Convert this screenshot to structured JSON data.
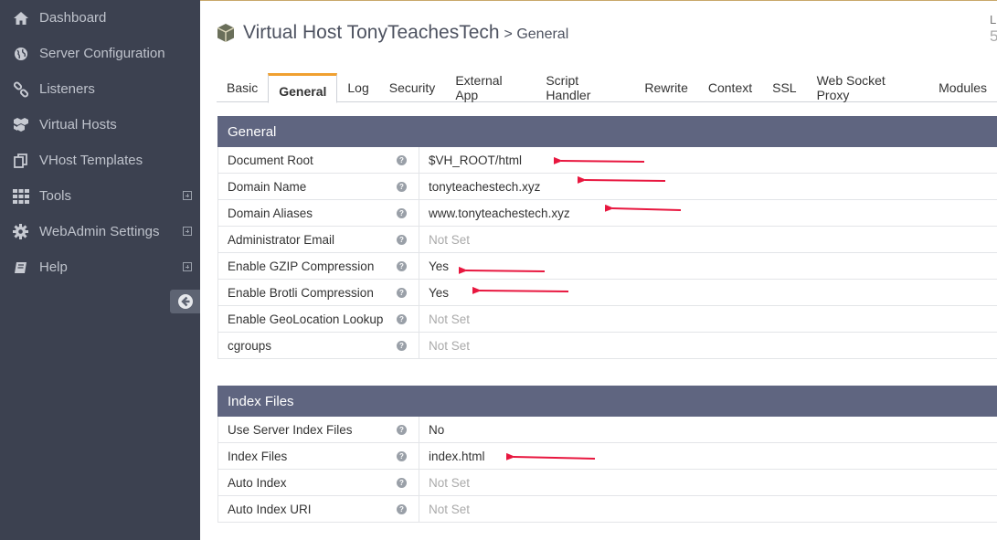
{
  "sidebar": {
    "items": [
      {
        "label": "Dashboard",
        "icon": "home-icon"
      },
      {
        "label": "Server Configuration",
        "icon": "globe-icon"
      },
      {
        "label": "Listeners",
        "icon": "link-icon"
      },
      {
        "label": "Virtual Hosts",
        "icon": "cubes-icon"
      },
      {
        "label": "VHost Templates",
        "icon": "copy-icon"
      },
      {
        "label": "Tools",
        "icon": "grid-icon"
      },
      {
        "label": "WebAdmin Settings",
        "icon": "gear-icon"
      },
      {
        "label": "Help",
        "icon": "book-icon"
      }
    ]
  },
  "header": {
    "title": "Virtual Host TonyTeachesTech",
    "subtitle": "> General",
    "corner_top": "L",
    "corner_bottom": "5"
  },
  "tabs": [
    "Basic",
    "General",
    "Log",
    "Security",
    "External App",
    "Script Handler",
    "Rewrite",
    "Context",
    "SSL",
    "Web Socket Proxy",
    "Modules"
  ],
  "active_tab": "General",
  "general": {
    "title": "General",
    "rows": [
      {
        "label": "Document Root",
        "value": "$VH_ROOT/html"
      },
      {
        "label": "Domain Name",
        "value": "tonyteachestech.xyz"
      },
      {
        "label": "Domain Aliases",
        "value": "www.tonyteachestech.xyz"
      },
      {
        "label": "Administrator Email",
        "value": "Not Set"
      },
      {
        "label": "Enable GZIP Compression",
        "value": "Yes"
      },
      {
        "label": "Enable Brotli Compression",
        "value": "Yes"
      },
      {
        "label": "Enable GeoLocation Lookup",
        "value": "Not Set"
      },
      {
        "label": "cgroups",
        "value": "Not Set"
      }
    ]
  },
  "index_files": {
    "title": "Index Files",
    "rows": [
      {
        "label": "Use Server Index Files",
        "value": "No"
      },
      {
        "label": "Index Files",
        "value": "index.html"
      },
      {
        "label": "Auto Index",
        "value": "Not Set"
      },
      {
        "label": "Auto Index URI",
        "value": "Not Set"
      }
    ]
  },
  "help_glyph": "?",
  "colors": {
    "sidebar_bg": "#3c4150",
    "section_header": "#5f6580",
    "active_tab_accent": "#f0a030",
    "annotation_arrow": "#e8173f"
  }
}
